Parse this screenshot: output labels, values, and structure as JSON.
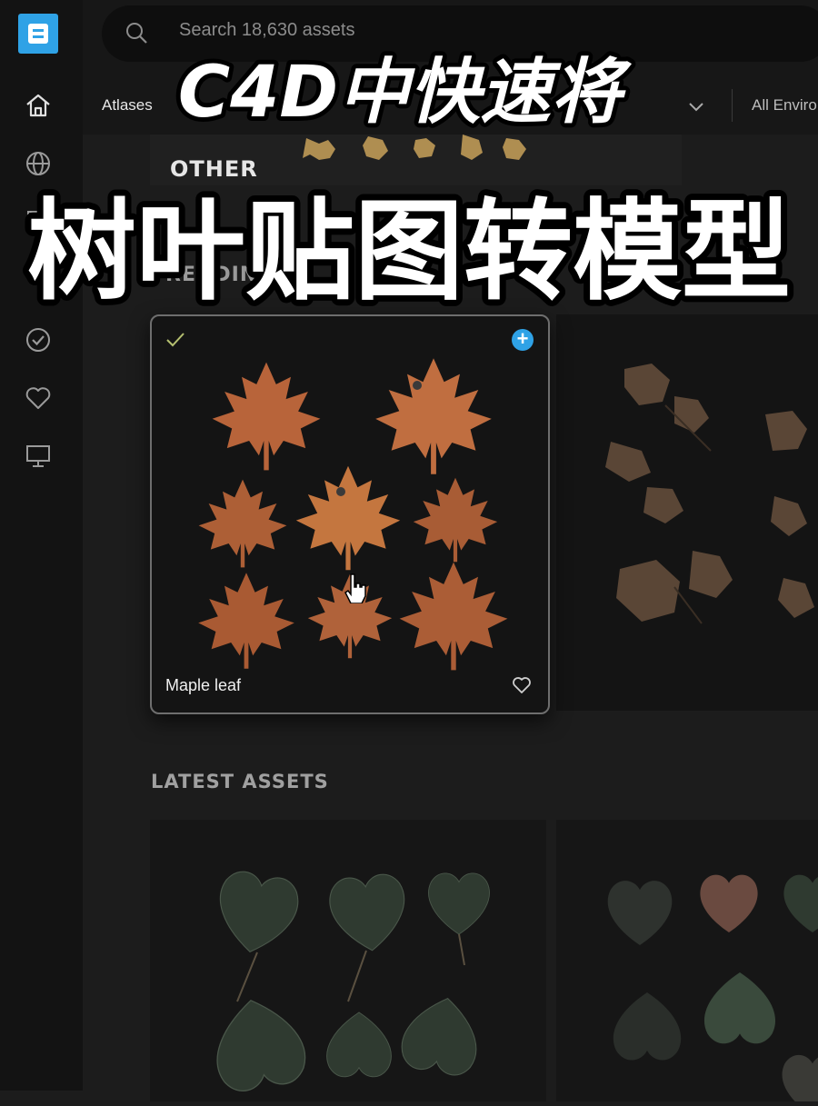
{
  "search": {
    "placeholder": "Search 18,630 assets"
  },
  "filters": {
    "atlases_label": "Atlases",
    "environment_label": "All Enviro"
  },
  "sections": {
    "other": "OTHER",
    "trending": "TRENDING",
    "latest": "LATEST ASSETS"
  },
  "featured_card": {
    "title": "Maple leaf",
    "selected": true
  },
  "overlay": {
    "line1": "C4D中快速将",
    "line2": "树叶贴图转模型"
  },
  "sidebar": {
    "items": [
      "home-icon",
      "globe-icon",
      "tag-icon",
      "check-circle-icon",
      "heart-icon",
      "monitor-icon"
    ]
  },
  "colors": {
    "accent": "#2fa2e6",
    "leaf_orange": "#b8643a",
    "leaf_green": "#2f3a30"
  }
}
